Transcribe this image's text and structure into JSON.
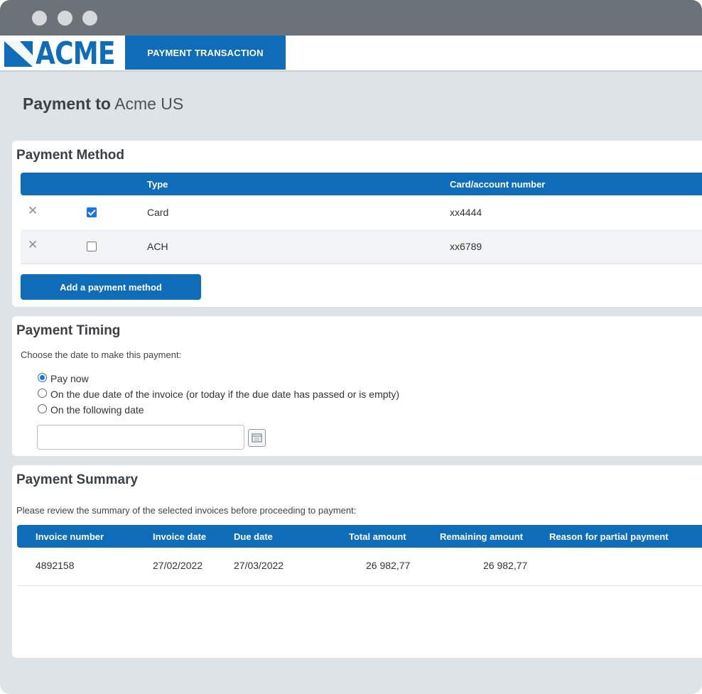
{
  "app": {
    "logo_text": "ACME",
    "active_tab": "PAYMENT TRANSACTION"
  },
  "page": {
    "title_prefix": "Payment to",
    "title_payee": "Acme US"
  },
  "payment_method": {
    "title": "Payment Method",
    "columns": [
      "",
      "",
      "Type",
      "Card/account number"
    ],
    "rows": [
      {
        "remove_icon": "close-icon",
        "selected": true,
        "type": "Card",
        "number": "xx4444"
      },
      {
        "remove_icon": "close-icon",
        "selected": false,
        "type": "ACH",
        "number": "xx6789"
      }
    ],
    "add_button": "Add a payment method"
  },
  "payment_timing": {
    "title": "Payment Timing",
    "prompt": "Choose the date to make this payment:",
    "options": [
      {
        "label": "Pay now",
        "selected": true
      },
      {
        "label": "On the due date of the invoice (or today if the due date has passed or is empty)",
        "selected": false
      },
      {
        "label": "On the following date",
        "selected": false
      }
    ],
    "date_value": "",
    "calendar_icon": "calendar-icon"
  },
  "payment_summary": {
    "title": "Payment Summary",
    "prompt": "Please review the summary of the selected invoices before proceeding to payment:",
    "columns": [
      "Invoice number",
      "Invoice date",
      "Due date",
      "Total amount",
      "Remaining amount",
      "Reason for partial payment"
    ],
    "rows": [
      {
        "invoice_number": "4892158",
        "invoice_date": "27/02/2022",
        "due_date": "27/03/2022",
        "total_amount": "26 982,77",
        "remaining_amount": "26 982,77",
        "reason": ""
      }
    ]
  },
  "colors": {
    "brand_blue": "#0f6cb8",
    "titlebar": "#6b7378",
    "page_bg": "#dde3e6"
  }
}
